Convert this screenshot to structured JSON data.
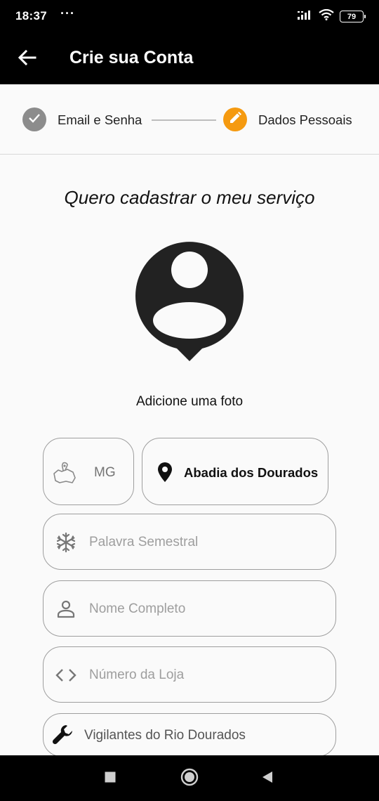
{
  "status_bar": {
    "time": "18:37",
    "dots": "···",
    "battery": "79",
    "icons": [
      "signal-icon",
      "wifi-icon",
      "battery-icon"
    ]
  },
  "app_bar": {
    "title": "Crie sua Conta",
    "back_icon": "arrow-left-icon"
  },
  "stepper": {
    "steps": [
      {
        "label": "Email e Senha",
        "state": "completed",
        "icon": "check-icon",
        "color": "#8c8c8c"
      },
      {
        "label": "Dados Pessoais",
        "state": "active",
        "icon": "pencil-icon",
        "color": "#f59a10"
      }
    ]
  },
  "heading": "Quero cadastrar o meu serviço",
  "photo": {
    "icon": "account-pin-icon",
    "label": "Adicione uma foto"
  },
  "form": {
    "state": {
      "icon": "map-location-icon",
      "value": "MG"
    },
    "city": {
      "icon": "location-pin-icon",
      "value": "Abadia dos Dourados"
    },
    "fields": [
      {
        "icon": "snowflake-icon",
        "placeholder": "Palavra Semestral",
        "value": ""
      },
      {
        "icon": "person-icon",
        "placeholder": "Nome Completo",
        "value": ""
      },
      {
        "icon": "code-icon",
        "placeholder": "Número da Loja",
        "value": ""
      },
      {
        "icon": "wrench-icon",
        "placeholder": "",
        "value": "Vigilantes do Rio Dourados"
      }
    ]
  },
  "nav_bar": {
    "icons": [
      "square-recent-icon",
      "circle-home-icon",
      "triangle-back-icon"
    ]
  },
  "colors": {
    "accent": "#f59a10",
    "completed": "#8c8c8c",
    "app_bar": "#000000",
    "background": "#fafafa",
    "field_border": "#9e9e9e"
  }
}
